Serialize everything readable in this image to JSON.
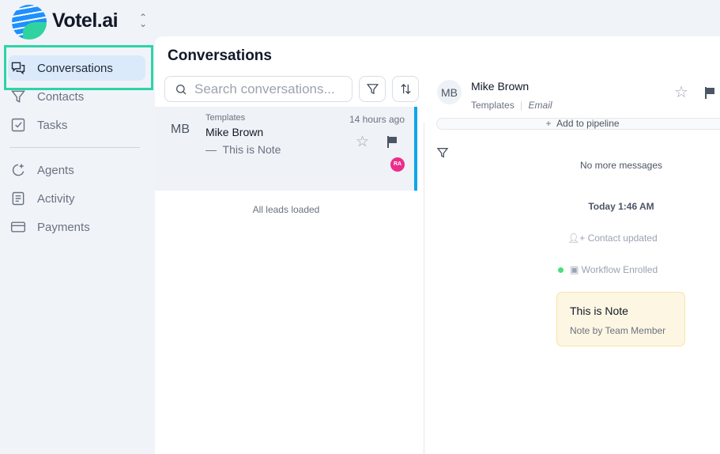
{
  "brand": {
    "name": "Votel.ai"
  },
  "sidebar": {
    "items": [
      {
        "label": "Conversations",
        "icon": "chat-bubbles-icon",
        "active": true
      },
      {
        "label": "Contacts",
        "icon": "funnel-icon"
      },
      {
        "label": "Tasks",
        "icon": "checkbox-icon"
      },
      {
        "label": "Agents",
        "icon": "sparkle-moon-icon"
      },
      {
        "label": "Activity",
        "icon": "document-list-icon"
      },
      {
        "label": "Payments",
        "icon": "credit-card-icon"
      }
    ]
  },
  "list": {
    "title": "Conversations",
    "search_placeholder": "Search conversations...",
    "conversations": [
      {
        "initials": "MB",
        "tag": "Templates",
        "name": "Mike Brown",
        "preview": "This is Note",
        "time": "14 hours ago",
        "assignee": "RA"
      }
    ],
    "footer": "All leads loaded"
  },
  "detail": {
    "initials": "MB",
    "name": "Mike Brown",
    "tag": "Templates",
    "channel": "Email",
    "add_pipeline": "Add to pipeline",
    "no_more": "No more messages",
    "date": "Today 1:46 AM",
    "event1": "Contact updated",
    "event2": "Workflow Enrolled",
    "note": {
      "text": "This is Note",
      "by": "Note by Team Member"
    }
  },
  "colors": {
    "accent": "#0ea5e9",
    "highlight": "#2dd4a8",
    "assignee": "#ec2d8c",
    "note_bg": "#fdf6e3"
  }
}
